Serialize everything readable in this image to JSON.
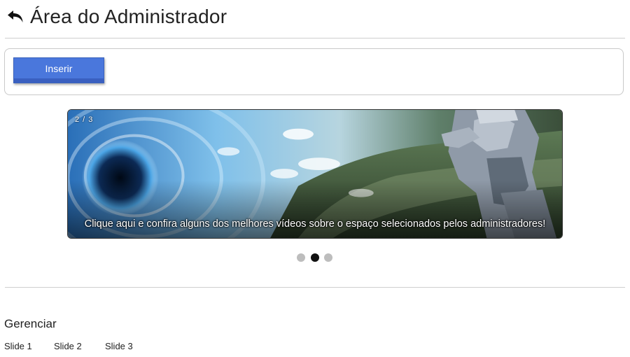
{
  "header": {
    "back_icon": "undo-arrow-icon",
    "title": "Área do Administrador"
  },
  "toolbar": {
    "insert_label": "Inserir",
    "insert_color": "#4a77dc"
  },
  "carousel": {
    "counter": "2 / 3",
    "caption": "Clique aqui e confira alguns dos melhores vídeos sobre o espaço selecionados pelos administradores!",
    "image": "space-astronaut-black-hole-image",
    "active_index": 2,
    "total": 3
  },
  "manage": {
    "title": "Gerenciar",
    "slides": [
      "Slide 1",
      "Slide 2",
      "Slide 3"
    ]
  }
}
